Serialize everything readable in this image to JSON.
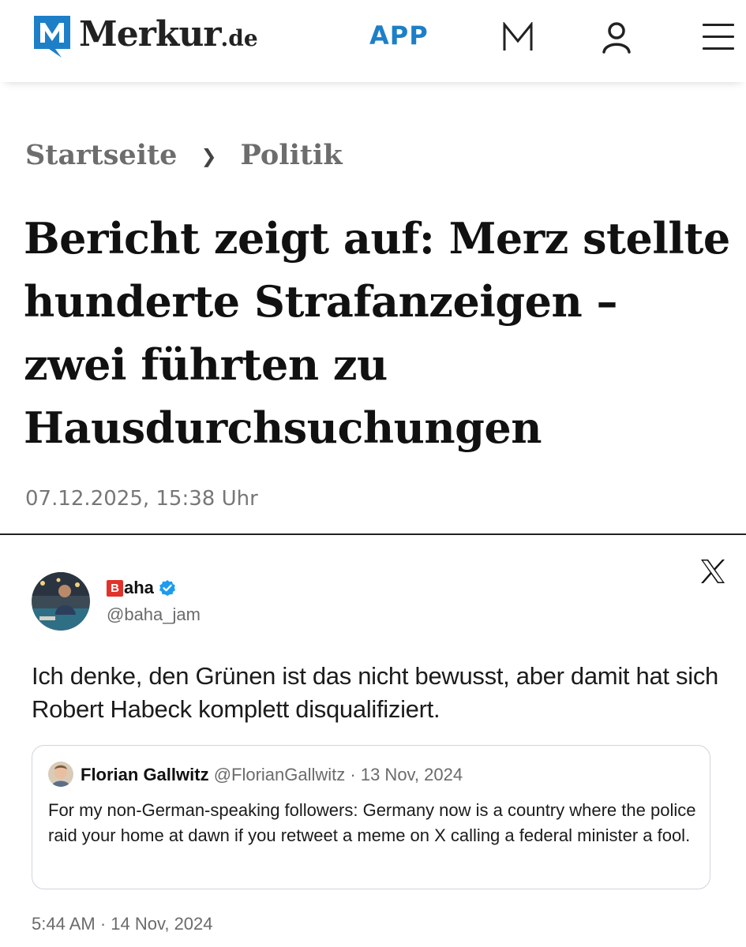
{
  "header": {
    "brand": "Merkur",
    "brand_tld": ".de",
    "app_label": "APP",
    "icons": [
      "merkur-logo-icon",
      "m-icon",
      "user-icon",
      "menu-icon"
    ],
    "brand_color": "#1d7fc7"
  },
  "breadcrumb": {
    "home": "Startseite",
    "separator": "❯",
    "section": "Politik"
  },
  "article": {
    "headline": "Bericht zeigt auf: Merz stellte hunderte Strafanzeigen – zwei führten zu Hausdurchsuchungen",
    "date": "07.12.2025, 15:38 Uhr"
  },
  "tweet": {
    "author_badge": "B",
    "author_name": "aha",
    "handle": "@baha_jam",
    "verified": true,
    "text": "Ich denke, den Grünen ist das nicht bewusst, aber damit hat sich Robert Habeck komplett disqualifiziert.",
    "timestamp": "5:44 AM · 14 Nov, 2024",
    "icons": [
      "x-logo-icon",
      "verified-icon"
    ],
    "quote": {
      "author_name": "Florian Gallwitz",
      "handle_date": "@FlorianGallwitz · 13 Nov, 2024",
      "text": "For my non-German-speaking followers: Germany now is a country where the police raid your home at dawn if you retweet a meme on X calling a federal minister a fool."
    }
  }
}
